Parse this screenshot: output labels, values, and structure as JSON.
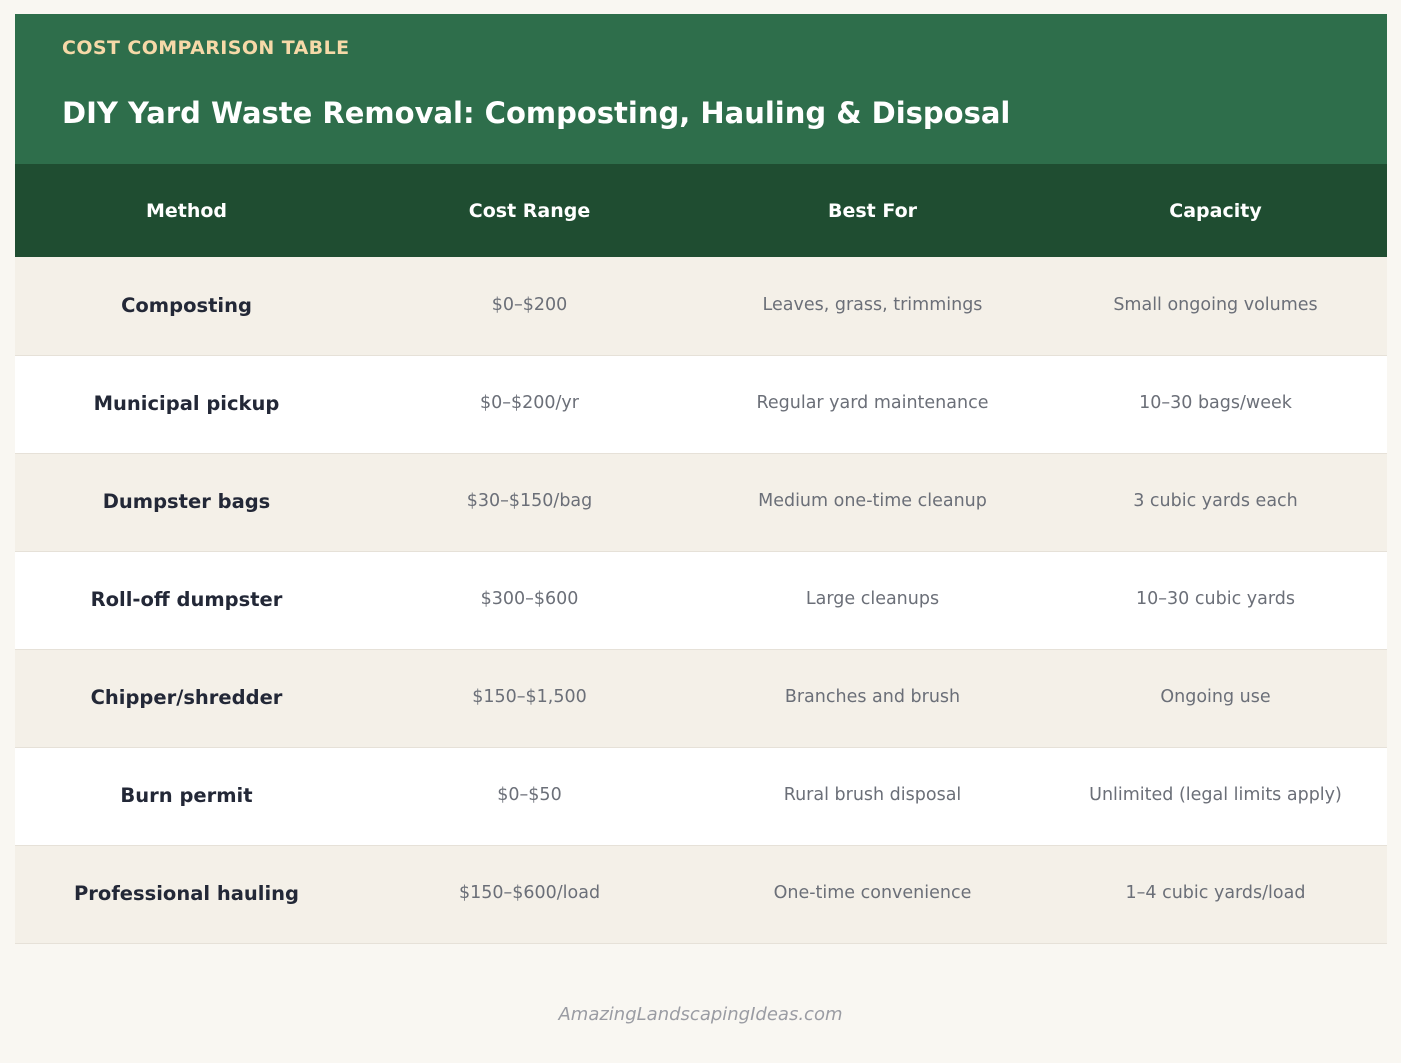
{
  "header": {
    "eyebrow": "COST COMPARISON TABLE",
    "title": "DIY Yard Waste Removal: Composting, Hauling & Disposal"
  },
  "table": {
    "columns": [
      "Method",
      "Cost Range",
      "Best For",
      "Capacity"
    ],
    "rows": [
      {
        "method": "Composting",
        "cost": "$0–$200",
        "best_for": "Leaves, grass, trimmings",
        "capacity": "Small ongoing volumes"
      },
      {
        "method": "Municipal pickup",
        "cost": "$0–$200/yr",
        "best_for": "Regular yard maintenance",
        "capacity": "10–30 bags/week"
      },
      {
        "method": "Dumpster bags",
        "cost": "$30–$150/bag",
        "best_for": "Medium one-time cleanup",
        "capacity": "3 cubic yards each"
      },
      {
        "method": "Roll-off dumpster",
        "cost": "$300–$600",
        "best_for": "Large cleanups",
        "capacity": "10–30 cubic yards"
      },
      {
        "method": "Chipper/shredder",
        "cost": "$150–$1,500",
        "best_for": "Branches and brush",
        "capacity": "Ongoing use"
      },
      {
        "method": "Burn permit",
        "cost": "$0–$50",
        "best_for": "Rural brush disposal",
        "capacity": "Unlimited (legal limits apply)"
      },
      {
        "method": "Professional hauling",
        "cost": "$150–$600/load",
        "best_for": "One-time convenience",
        "capacity": "1–4 cubic yards/load"
      }
    ]
  },
  "footer": {
    "source": "AmazingLandscapingIdeas.com"
  },
  "colors": {
    "header_bg": "#2e6e4b",
    "table_head_bg": "#1f4d31",
    "eyebrow": "#f6d9a8",
    "row_alt": "#f4f0e8",
    "page_bg": "#f9f7f2"
  }
}
